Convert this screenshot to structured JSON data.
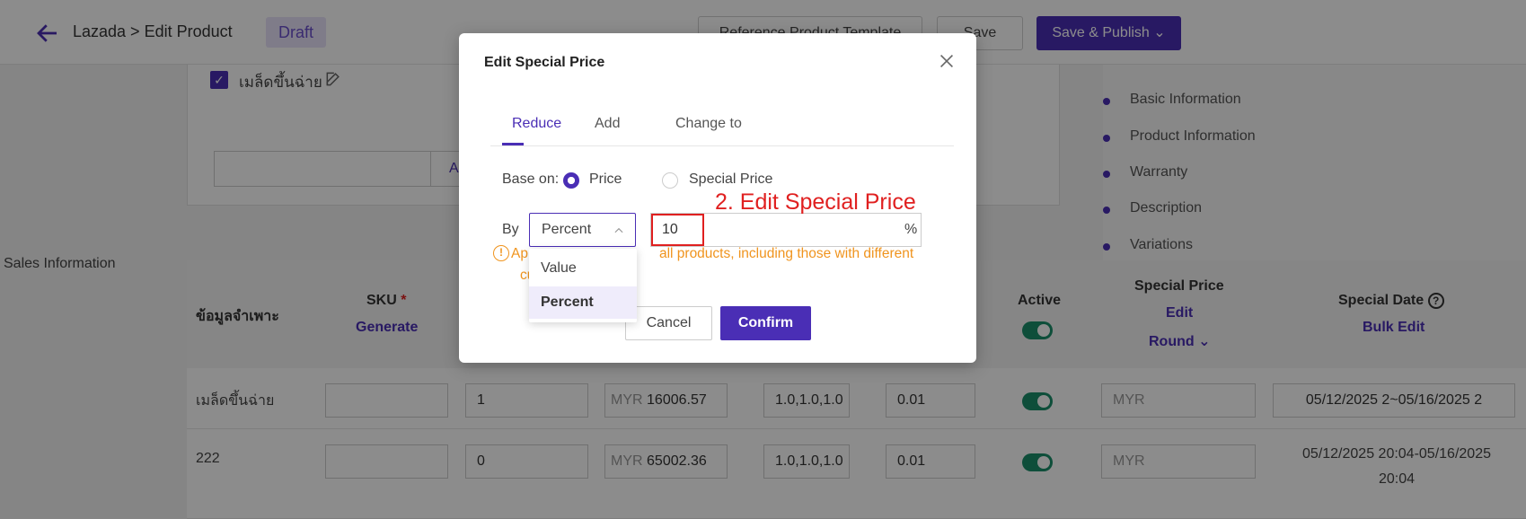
{
  "header": {
    "title": "Lazada > Edit Product",
    "status_badge": "Draft",
    "reference_button": "Reference Product Template",
    "save_button": "Save",
    "publish_button": "Save & Publish"
  },
  "product_card": {
    "variant_checkbox_label": "เมล็ดขึ้นฉ่าย",
    "apply_button_partial": "A"
  },
  "side_nav": {
    "items": [
      "Basic Information",
      "Product Information",
      "Warranty",
      "Description",
      "Variations"
    ]
  },
  "sales_information": {
    "section_label": "Sales Information",
    "headers": {
      "spec": "ข้อมูลจำเพาะ",
      "sku": "SKU",
      "sku_required": "*",
      "sku_action": "Generate",
      "active": "Active",
      "special_price": "Special Price",
      "special_price_edit": "Edit",
      "special_price_round": "Round",
      "special_date": "Special Date",
      "special_date_action": "Bulk Edit"
    },
    "rows": [
      {
        "name": "เมล็ดขึ้นฉ่าย",
        "sku": "",
        "qty": "1",
        "currency": "MYR",
        "price": "16006.57",
        "dims": "1.0,1.0,1.0",
        "weight": "0.01",
        "active": true,
        "special_price_placeholder": "MYR",
        "special_date": "05/12/2025 2~05/16/2025 2"
      },
      {
        "name": "222",
        "sku": "",
        "qty": "0",
        "currency": "MYR",
        "price": "65002.36",
        "dims": "1.0,1.0,1.0",
        "weight": "0.01",
        "active": true,
        "special_price_placeholder": "MYR",
        "special_date_line1": "05/12/2025 20:04-05/16/2025",
        "special_date_line2": "20:04"
      }
    ]
  },
  "modal": {
    "title": "Edit Special Price",
    "tabs": [
      "Reduce",
      "Add",
      "Change to"
    ],
    "active_tab": "Reduce",
    "base_on_label": "Base on:",
    "base_options": [
      "Price",
      "Special Price"
    ],
    "base_selected": "Price",
    "by_label": "By",
    "by_selected": "Percent",
    "by_options": [
      "Value",
      "Percent"
    ],
    "amount_value": "10",
    "amount_unit": "%",
    "warning_text": "Ap                         all products, including those with different cu",
    "warning_line1_visible": "Ap",
    "warning_line1_rest": "all products, including those with different",
    "warning_line2": "cu",
    "cancel_button": "Cancel",
    "confirm_button": "Confirm"
  },
  "annotation": {
    "label": "2. Edit Special Price",
    "color": "#e02020"
  },
  "colors": {
    "brand": "#4a2eb5",
    "warning": "#f0941e",
    "toggle_on": "#1a8f6a"
  }
}
